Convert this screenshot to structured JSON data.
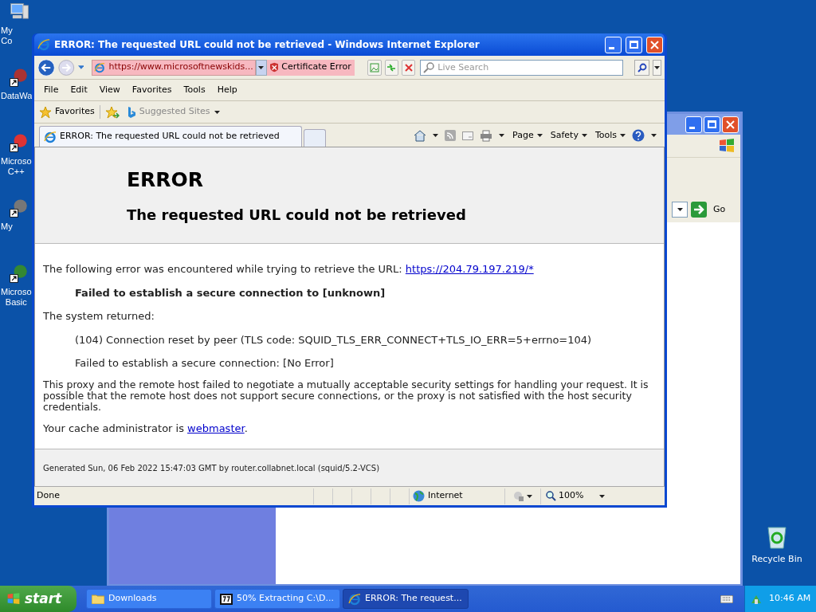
{
  "desktop_icons": [
    {
      "label": "My Co",
      "kind": "computer"
    },
    {
      "label": "DataWa",
      "kind": "shortcut"
    },
    {
      "label": "Microso C++",
      "kind": "shortcut"
    },
    {
      "label": "My",
      "kind": "shortcut"
    },
    {
      "label": "Microso Basic",
      "kind": "shortcut"
    }
  ],
  "recycle_bin": {
    "label": "Recycle Bin"
  },
  "background_window": {
    "go_button": "Go"
  },
  "browser": {
    "title": "ERROR: The requested URL could not be retrieved - Windows Internet Explorer",
    "address": "https://www.microsoftnewskids...",
    "certificate": "Certificate Error",
    "search": {
      "placeholder": "Live Search"
    },
    "menu": [
      "File",
      "Edit",
      "View",
      "Favorites",
      "Tools",
      "Help"
    ],
    "favorites": "Favorites",
    "suggested": "Suggested Sites",
    "tabs": [
      {
        "label": "ERROR: The requested URL could not be retrieved",
        "selected": true
      }
    ],
    "commands": [
      "Page",
      "Safety",
      "Tools"
    ],
    "page": {
      "heading": "ERROR",
      "subheading": "The requested URL could not be retrieved",
      "intro": "The following error was encountered while trying to retrieve the URL: ",
      "url": "https://204.79.197.219/*",
      "failure": "Failed to establish a secure connection to [unknown]",
      "system_label": "The system returned:",
      "system_lines": [
        "(104) Connection reset by peer (TLS code: SQUID_TLS_ERR_CONNECT+TLS_IO_ERR=5+errno=104)",
        "Failed to establish a secure connection: [No Error]"
      ],
      "explanation": "This proxy and the remote host failed to negotiate a mutually acceptable security settings for handling your request. It is possible that the remote host does not support secure connections, or the proxy is not satisfied with the host security credentials.",
      "admin_text": "Your cache administrator is ",
      "admin_link": "webmaster",
      "admin_end": ".",
      "footer": "Generated Sun, 06 Feb 2022 15:47:03 GMT by router.collabnet.local (squid/5.2-VCS)"
    },
    "status": {
      "text": "Done",
      "zone": "Internet",
      "zoom": "100%"
    }
  },
  "taskbar": {
    "start": "start",
    "items": [
      {
        "label": "Downloads",
        "kind": "folder",
        "selected": false
      },
      {
        "label": "50% Extracting C:\\D...",
        "kind": "archive",
        "selected": false
      },
      {
        "label": "ERROR: The request...",
        "kind": "browser",
        "selected": true
      }
    ],
    "clock": "10:46 AM"
  }
}
